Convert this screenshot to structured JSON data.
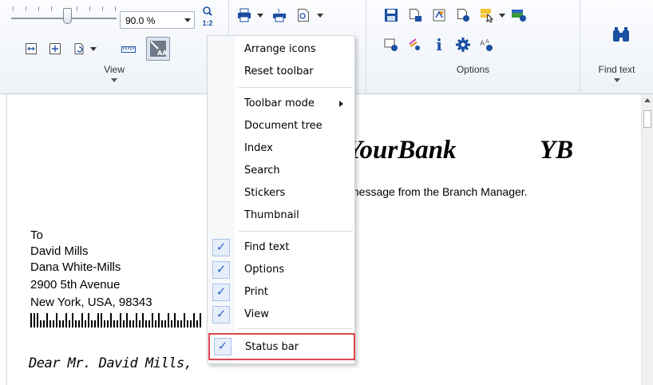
{
  "toolbar": {
    "zoom_value": "90.0 %",
    "zoom_one_to_one": "1:2",
    "groups": {
      "view_label": "View",
      "options_label": "Options",
      "find_label": "Find text"
    },
    "option_icon_text": "A₄"
  },
  "menu": {
    "items": [
      {
        "label": "Arrange icons",
        "checked": false
      },
      {
        "label": "Reset toolbar",
        "checked": false
      },
      {
        "label": "Toolbar mode",
        "checked": false,
        "submenu": true
      },
      {
        "label": "Document tree",
        "checked": false
      },
      {
        "label": "Index",
        "checked": false
      },
      {
        "label": "Search",
        "checked": false
      },
      {
        "label": "Stickers",
        "checked": false
      },
      {
        "label": "Thumbnail",
        "checked": false
      },
      {
        "label": "Find text",
        "checked": true
      },
      {
        "label": "Options",
        "checked": true
      },
      {
        "label": "Print",
        "checked": true
      },
      {
        "label": "View",
        "checked": true
      },
      {
        "label": "Status bar",
        "checked": true
      }
    ],
    "check_glyph": "✓"
  },
  "document": {
    "bank_name": "YourBank",
    "bank_logo": "YB",
    "bank_message": "message from the Branch Manager.",
    "address": [
      "To",
      "David Mills",
      "Dana White-Mills",
      "2900 5th Avenue",
      "New York, USA, 98343"
    ],
    "greeting": "Dear Mr. David Mills,"
  },
  "colors": {
    "accent": "#2e61c6",
    "highlight_border": "#e0464f",
    "icon_blue": "#1b4fa2",
    "icon_orange": "#e58b18"
  }
}
